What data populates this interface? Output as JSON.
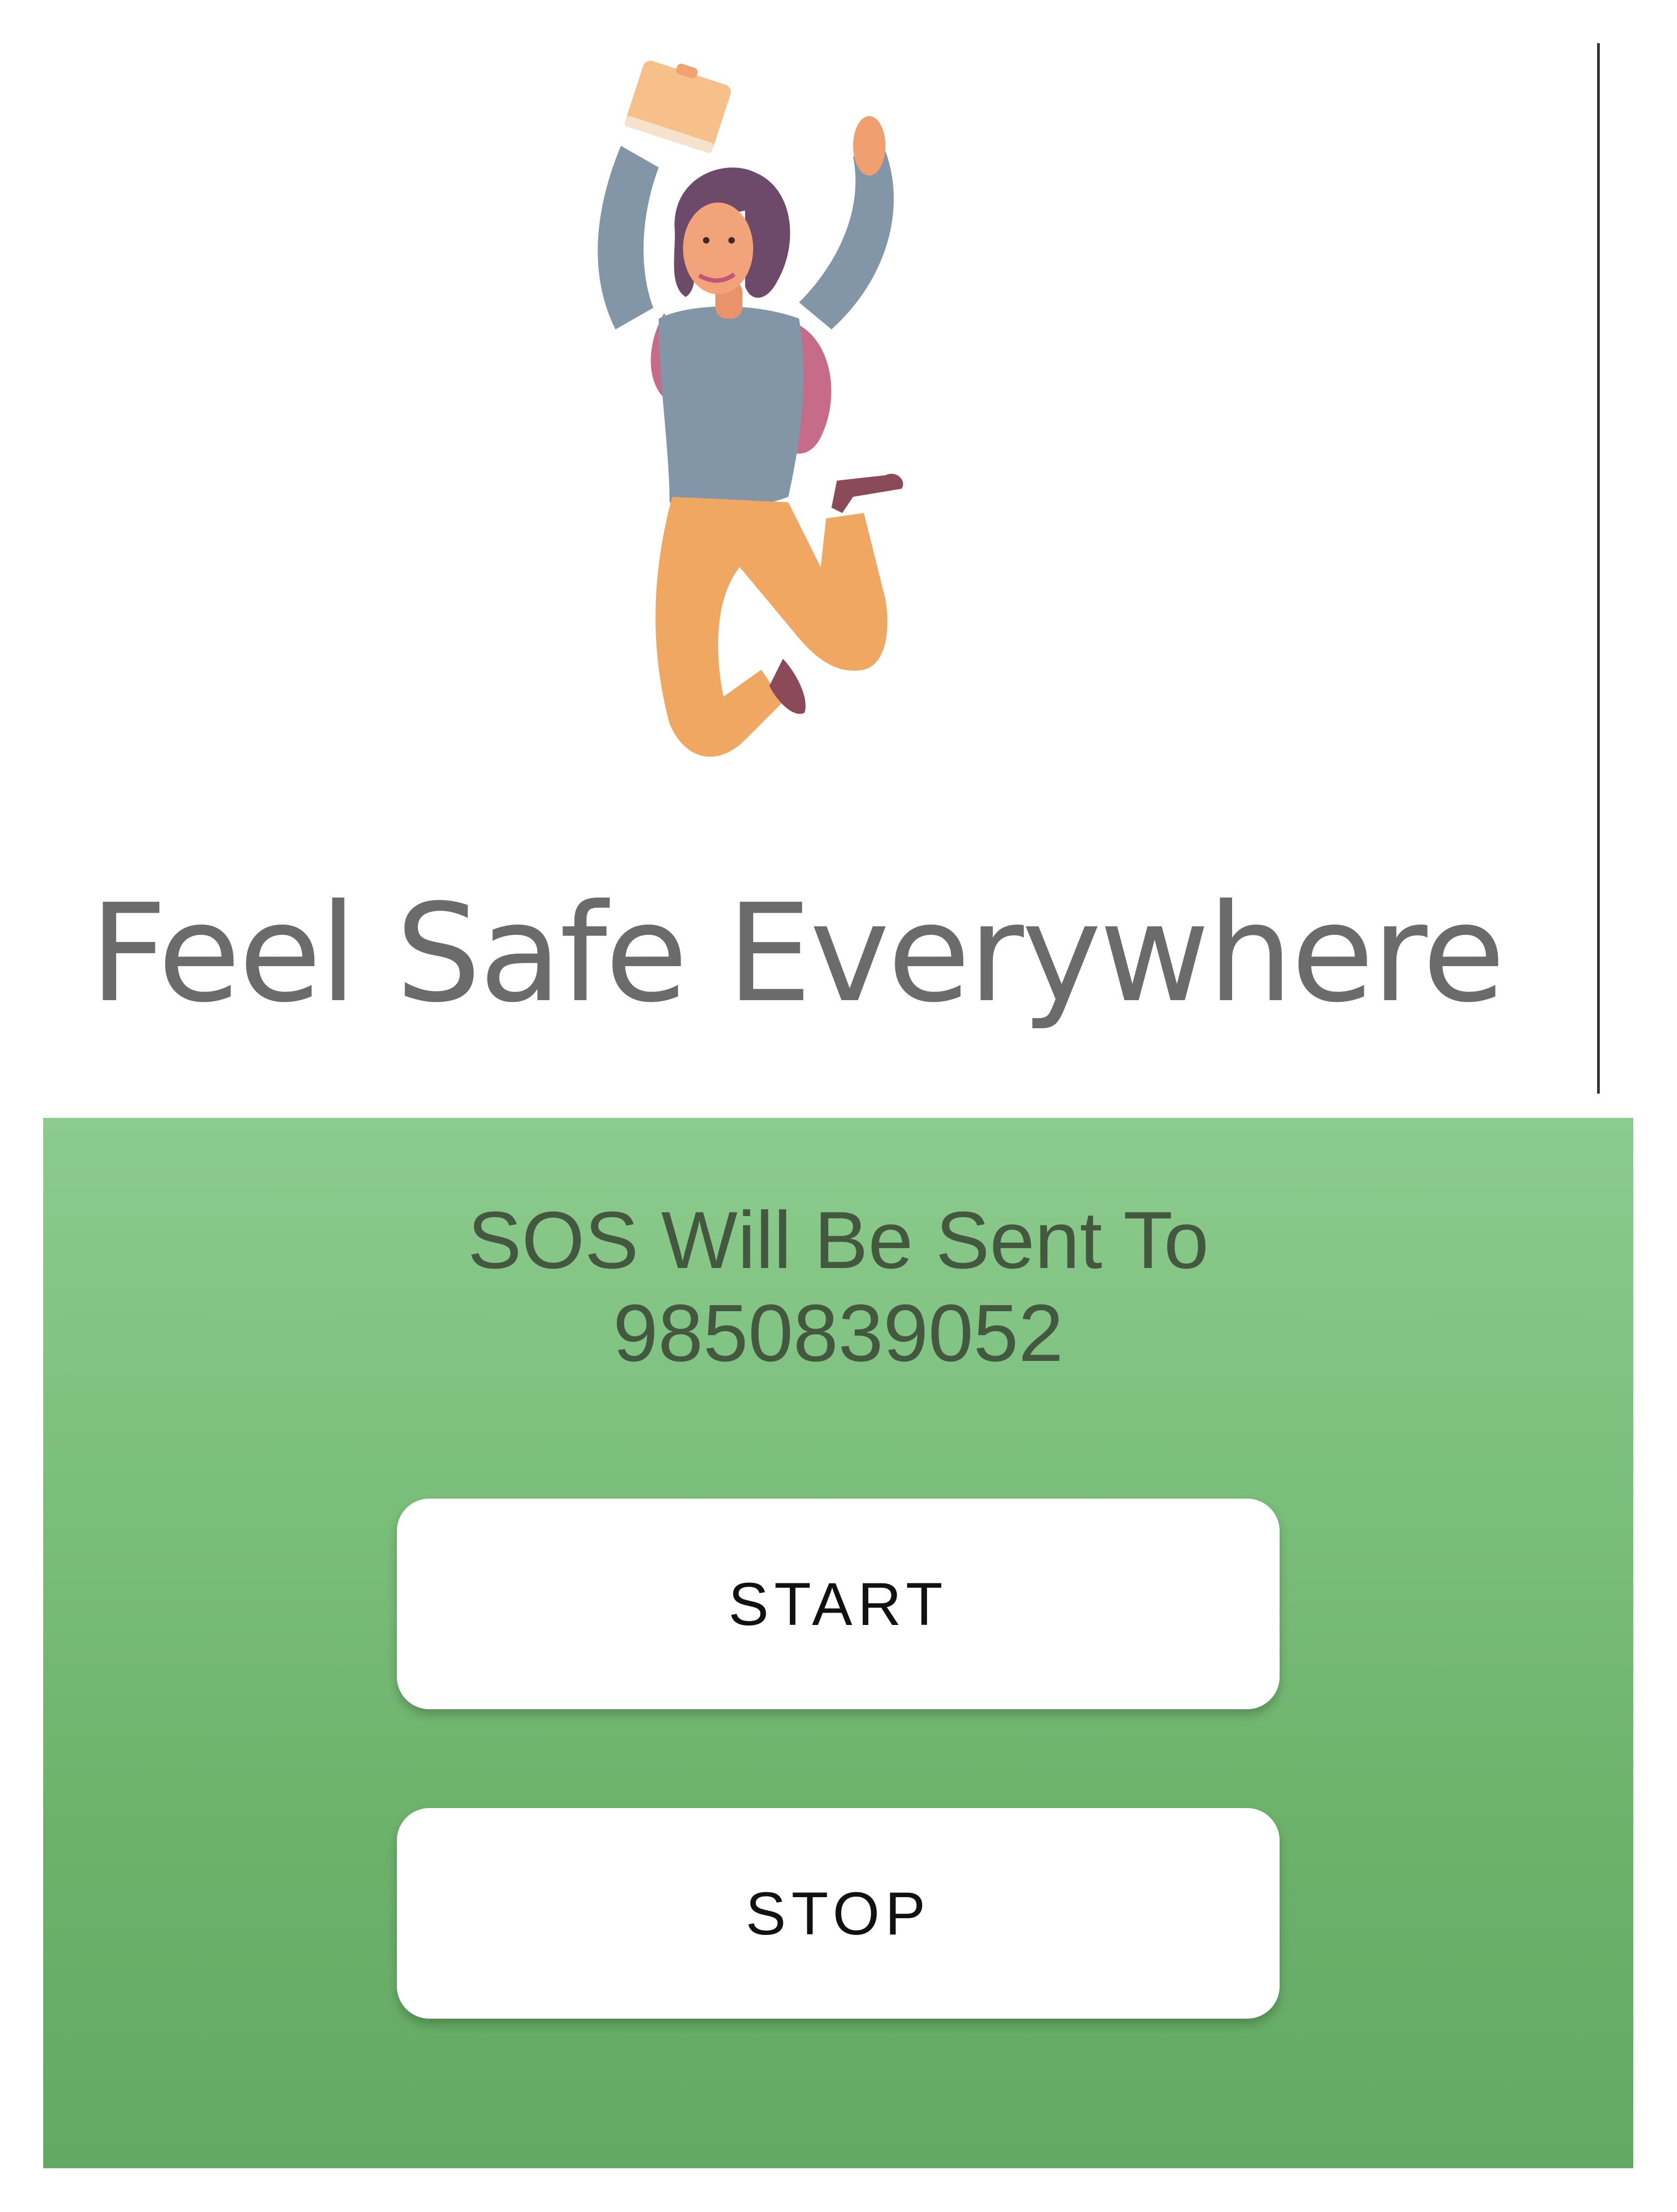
{
  "hero": {
    "illustration": "jumping-woman-illustration",
    "tagline": "Feel Safe Everywhere"
  },
  "sos": {
    "line1": "SOS Will Be Sent To",
    "phone": "9850839052"
  },
  "actions": {
    "start_label": "START",
    "stop_label": "STOP"
  },
  "colors": {
    "panel_top": "#8ccb8e",
    "panel_bottom": "#62a964",
    "tagline": "#6b6b6b",
    "sos_text": "#44573f"
  }
}
